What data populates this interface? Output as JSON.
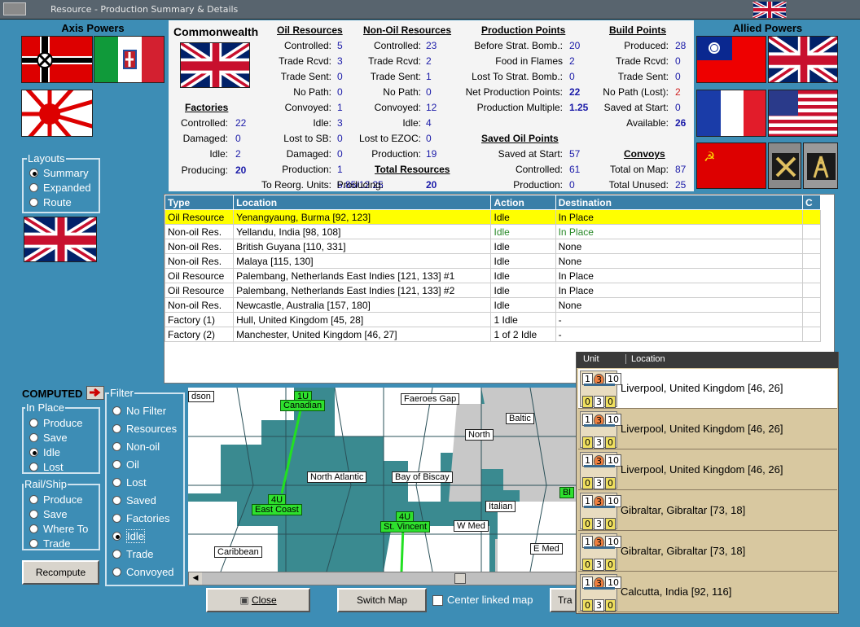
{
  "window": {
    "title": "Resource - Production Summary & Details"
  },
  "axis": {
    "title": "Axis Powers"
  },
  "allied": {
    "title": "Allied Powers"
  },
  "layouts": {
    "title": "Layouts",
    "options": [
      "Summary",
      "Expanded",
      "Route"
    ],
    "selected": 0
  },
  "summary": {
    "nation": "Commonwealth",
    "factories": {
      "title": "Factories",
      "rows": [
        [
          "Controlled:",
          "22"
        ],
        [
          "Damaged:",
          "0"
        ],
        [
          "Idle:",
          "2"
        ],
        [
          "Producing:",
          "20"
        ]
      ]
    },
    "oil": {
      "title": "Oil Resources",
      "rows": [
        [
          "Controlled:",
          "5"
        ],
        [
          "Trade Rcvd:",
          "3"
        ],
        [
          "Trade Sent:",
          "0"
        ],
        [
          "No Path:",
          "0"
        ],
        [
          "Convoyed:",
          "1"
        ],
        [
          "Idle:",
          "3"
        ],
        [
          "Lost to SB:",
          "0"
        ],
        [
          "Damaged:",
          "0"
        ],
        [
          "Production:",
          "1"
        ],
        [
          "To Reorg. Units:",
          "5.85/12.25"
        ]
      ]
    },
    "nonoil": {
      "title": "Non-Oil Resources",
      "rows": [
        [
          "Controlled:",
          "23"
        ],
        [
          "Trade Rcvd:",
          "2"
        ],
        [
          "Trade Sent:",
          "1"
        ],
        [
          "No Path:",
          "0"
        ],
        [
          "Convoyed:",
          "12"
        ],
        [
          "Idle:",
          "4"
        ],
        [
          "Lost to EZOC:",
          "0"
        ],
        [
          "Production:",
          "19"
        ]
      ]
    },
    "total": {
      "title": "Total Resources",
      "rows": [
        [
          "Producing:",
          "20"
        ]
      ]
    },
    "pp": {
      "title": "Production Points",
      "rows": [
        [
          "Before Strat. Bomb.:",
          "20"
        ],
        [
          "Food in Flames",
          "2"
        ],
        [
          "Lost To Strat. Bomb.:",
          "0"
        ],
        [
          "Net Production Points:",
          "22"
        ],
        [
          "Production Multiple:",
          "1.25"
        ]
      ]
    },
    "saved": {
      "title": "Saved Oil Points",
      "rows": [
        [
          "Saved at Start:",
          "57"
        ],
        [
          "Controlled:",
          "61"
        ],
        [
          "Production:",
          "0"
        ]
      ]
    },
    "bp": {
      "title": "Build Points",
      "rows": [
        [
          "Produced:",
          "28"
        ],
        [
          "Trade Rcvd:",
          "0"
        ],
        [
          "Trade Sent:",
          "0"
        ],
        [
          "No Path (Lost):",
          "2"
        ],
        [
          "Saved at Start:",
          "0"
        ],
        [
          "Available:",
          "26"
        ]
      ]
    },
    "convoys": {
      "title": "Convoys",
      "rows": [
        [
          "Total on Map:",
          "87"
        ],
        [
          "Total Unused:",
          "25"
        ]
      ]
    }
  },
  "table": {
    "headers": [
      "Type",
      "Location",
      "Action",
      "Destination",
      "C"
    ],
    "rows": [
      [
        "Oil Resource",
        "Yenangyaung, Burma [92, 123]",
        "Idle",
        "In Place"
      ],
      [
        "Non-oil Res.",
        "Yellandu, India [98, 108]",
        "Idle",
        "In Place"
      ],
      [
        "Non-oil Res.",
        "British Guyana [110, 331]",
        "Idle",
        "None"
      ],
      [
        "Non-oil Res.",
        "Malaya [115, 130]",
        "Idle",
        "None"
      ],
      [
        "Oil Resource",
        "Palembang, Netherlands East Indies [121, 133] #1",
        "Idle",
        "In Place"
      ],
      [
        "Oil Resource",
        "Palembang, Netherlands East Indies [121, 133] #2",
        "Idle",
        "In Place"
      ],
      [
        "Non-oil Res.",
        "Newcastle, Australia [157, 180]",
        "Idle",
        "None"
      ],
      [
        "Factory (1)",
        "Hull, United Kingdom [45, 28]",
        "1 Idle",
        "-"
      ],
      [
        "Factory (2)",
        "Manchester, United Kingdom [46, 27]",
        "1 of 2 Idle",
        "-"
      ]
    ]
  },
  "computed": {
    "label": "COMPUTED"
  },
  "inplace": {
    "title": "In Place",
    "options": [
      "Produce",
      "Save",
      "Idle",
      "Lost"
    ],
    "selected": 2
  },
  "railship": {
    "title": "Rail/Ship",
    "options": [
      "Produce",
      "Save",
      "Where To",
      "Trade"
    ]
  },
  "filter": {
    "title": "Filter",
    "options": [
      "No Filter",
      "Resources",
      "Non-oil",
      "Oil",
      "Lost",
      "Saved",
      "Factories",
      "Idle",
      "Trade",
      "Convoyed"
    ],
    "selected": 7
  },
  "buttons": {
    "recompute": "Recompute",
    "close": "Close",
    "switch_map": "Switch Map",
    "center_linked": "Center linked map",
    "trade": "Tra"
  },
  "map": {
    "labels": [
      "dson",
      "Faeroes Gap",
      "Baltic",
      "North",
      "North Atlantic",
      "Bay of Biscay",
      "Italian",
      "W Med",
      "Caribbean",
      "E Med"
    ],
    "tags": [
      [
        "1U",
        "Canadian"
      ],
      [
        "4U",
        "East Coast"
      ],
      [
        "4U",
        "St. Vincent"
      ],
      [
        "",
        "Bl"
      ]
    ]
  },
  "units": {
    "headers": [
      "Unit",
      "Location"
    ],
    "items": [
      "Liverpool, United Kingdom [46, 26]",
      "Liverpool, United Kingdom [46, 26]",
      "Liverpool, United Kingdom [46, 26]",
      "Gibraltar, Gibraltar [73, 18]",
      "Gibraltar, Gibraltar [73, 18]",
      "Calcutta, India [92, 116]"
    ],
    "stats": [
      "1",
      "3",
      "10",
      "0",
      "3",
      "0"
    ]
  },
  "colors": {
    "bg": "#3d8db5",
    "highlight": "#ffff00",
    "header": "#3a7fa8",
    "value": "#1a1aa8"
  }
}
